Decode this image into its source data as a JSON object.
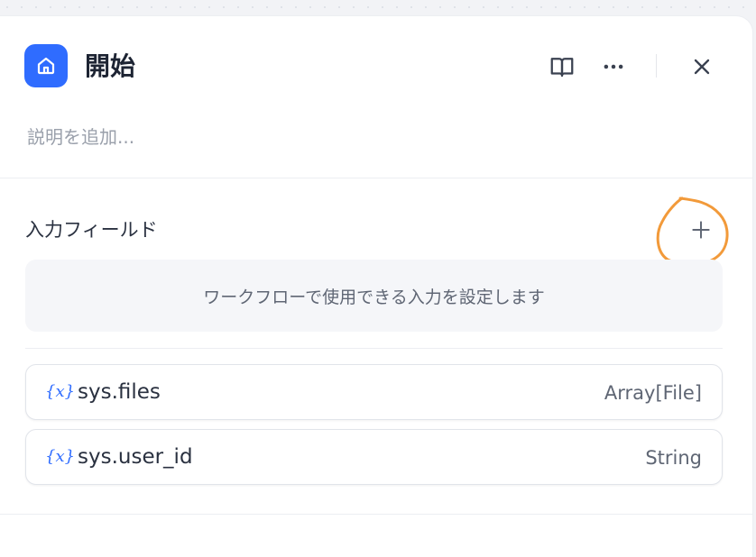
{
  "node": {
    "title": "開始",
    "icon": "home-icon",
    "accent": "#2f6cff",
    "description_placeholder": "説明を追加..."
  },
  "header_actions": {
    "book": "book-icon",
    "more": "more-icon",
    "close": "close-icon"
  },
  "input_fields": {
    "title": "入力フィールド",
    "add_icon": "plus-icon",
    "empty_text": "ワークフローで使用できる入力を設定します"
  },
  "system_variables": [
    {
      "icon": "{x}",
      "name": "sys.files",
      "type": "Array[File]"
    },
    {
      "icon": "{x}",
      "name": "sys.user_id",
      "type": "String"
    }
  ],
  "annotation_color": "#f29a3a"
}
